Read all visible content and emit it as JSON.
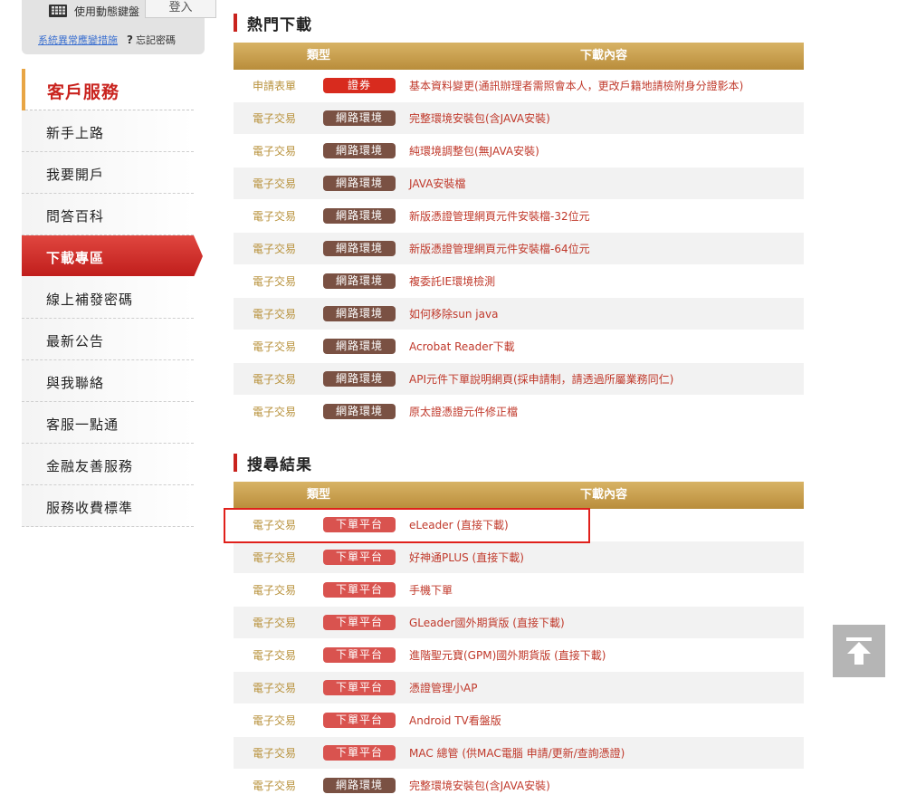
{
  "login": {
    "keyboard_label": "使用動態鍵盤",
    "login_button": "登入",
    "system_link": "系統異常應變措施",
    "help_mark": "?",
    "forgot_label": "忘記密碼"
  },
  "sidebar": {
    "header": "客戶服務",
    "items": [
      {
        "label": "新手上路"
      },
      {
        "label": "我要開戶"
      },
      {
        "label": "問答百科"
      },
      {
        "label": "下載專區"
      },
      {
        "label": "線上補發密碼"
      },
      {
        "label": "最新公告"
      },
      {
        "label": "與我聯絡"
      },
      {
        "label": "客服一點通"
      },
      {
        "label": "金融友善服務"
      },
      {
        "label": "服務收費標準"
      }
    ],
    "active_index": 3
  },
  "hot_downloads": {
    "title": "熱門下載",
    "columns": [
      "類型",
      "下載內容"
    ],
    "rows": [
      {
        "category": "申請表單",
        "tag": "證券",
        "tag_color": "#d82b1e",
        "content": "基本資料變更(通訊辦理者需照會本人，更改戶籍地請檢附身分證影本)"
      },
      {
        "category": "電子交易",
        "tag": "網路環境",
        "tag_color": "#7a5143",
        "content": "完整環境安裝包(含JAVA安裝)"
      },
      {
        "category": "電子交易",
        "tag": "網路環境",
        "tag_color": "#7a5143",
        "content": "純環境調整包(無JAVA安裝)"
      },
      {
        "category": "電子交易",
        "tag": "網路環境",
        "tag_color": "#7a5143",
        "content": "JAVA安裝檔"
      },
      {
        "category": "電子交易",
        "tag": "網路環境",
        "tag_color": "#7a5143",
        "content": "新版憑證管理網頁元件安裝檔-32位元"
      },
      {
        "category": "電子交易",
        "tag": "網路環境",
        "tag_color": "#7a5143",
        "content": "新版憑證管理網頁元件安裝檔-64位元"
      },
      {
        "category": "電子交易",
        "tag": "網路環境",
        "tag_color": "#7a5143",
        "content": "複委託IE環境檢測"
      },
      {
        "category": "電子交易",
        "tag": "網路環境",
        "tag_color": "#7a5143",
        "content": "如何移除sun java"
      },
      {
        "category": "電子交易",
        "tag": "網路環境",
        "tag_color": "#7a5143",
        "content": "Acrobat Reader下載"
      },
      {
        "category": "電子交易",
        "tag": "網路環境",
        "tag_color": "#7a5143",
        "content": "API元件下單說明網頁(採申請制，請透過所屬業務同仁)"
      },
      {
        "category": "電子交易",
        "tag": "網路環境",
        "tag_color": "#7a5143",
        "content": "原太證憑證元件修正檔"
      }
    ]
  },
  "search_results": {
    "title": "搜尋結果",
    "columns": [
      "類型",
      "下載內容"
    ],
    "rows": [
      {
        "category": "電子交易",
        "tag": "下單平台",
        "tag_color": "#d9534f",
        "content": "eLeader (直接下載)"
      },
      {
        "category": "電子交易",
        "tag": "下單平台",
        "tag_color": "#d9534f",
        "content": "好神通PLUS (直接下載)"
      },
      {
        "category": "電子交易",
        "tag": "下單平台",
        "tag_color": "#d9534f",
        "content": "手機下單"
      },
      {
        "category": "電子交易",
        "tag": "下單平台",
        "tag_color": "#d9534f",
        "content": "GLeader國外期貨版 (直接下載)"
      },
      {
        "category": "電子交易",
        "tag": "下單平台",
        "tag_color": "#d9534f",
        "content": "進階聖元寶(GPM)國外期貨版 (直接下載)"
      },
      {
        "category": "電子交易",
        "tag": "下單平台",
        "tag_color": "#d9534f",
        "content": "憑證管理小AP"
      },
      {
        "category": "電子交易",
        "tag": "下單平台",
        "tag_color": "#d9534f",
        "content": "Android TV看盤版"
      },
      {
        "category": "電子交易",
        "tag": "下單平台",
        "tag_color": "#d9534f",
        "content": "MAC 總管 (供MAC電腦 申請/更新/查詢憑證)"
      },
      {
        "category": "電子交易",
        "tag": "網路環境",
        "tag_color": "#7a5143",
        "content": "完整環境安裝包(含JAVA安裝)"
      }
    ]
  },
  "scroll_top": {
    "icon": "arrow-up-icon"
  }
}
